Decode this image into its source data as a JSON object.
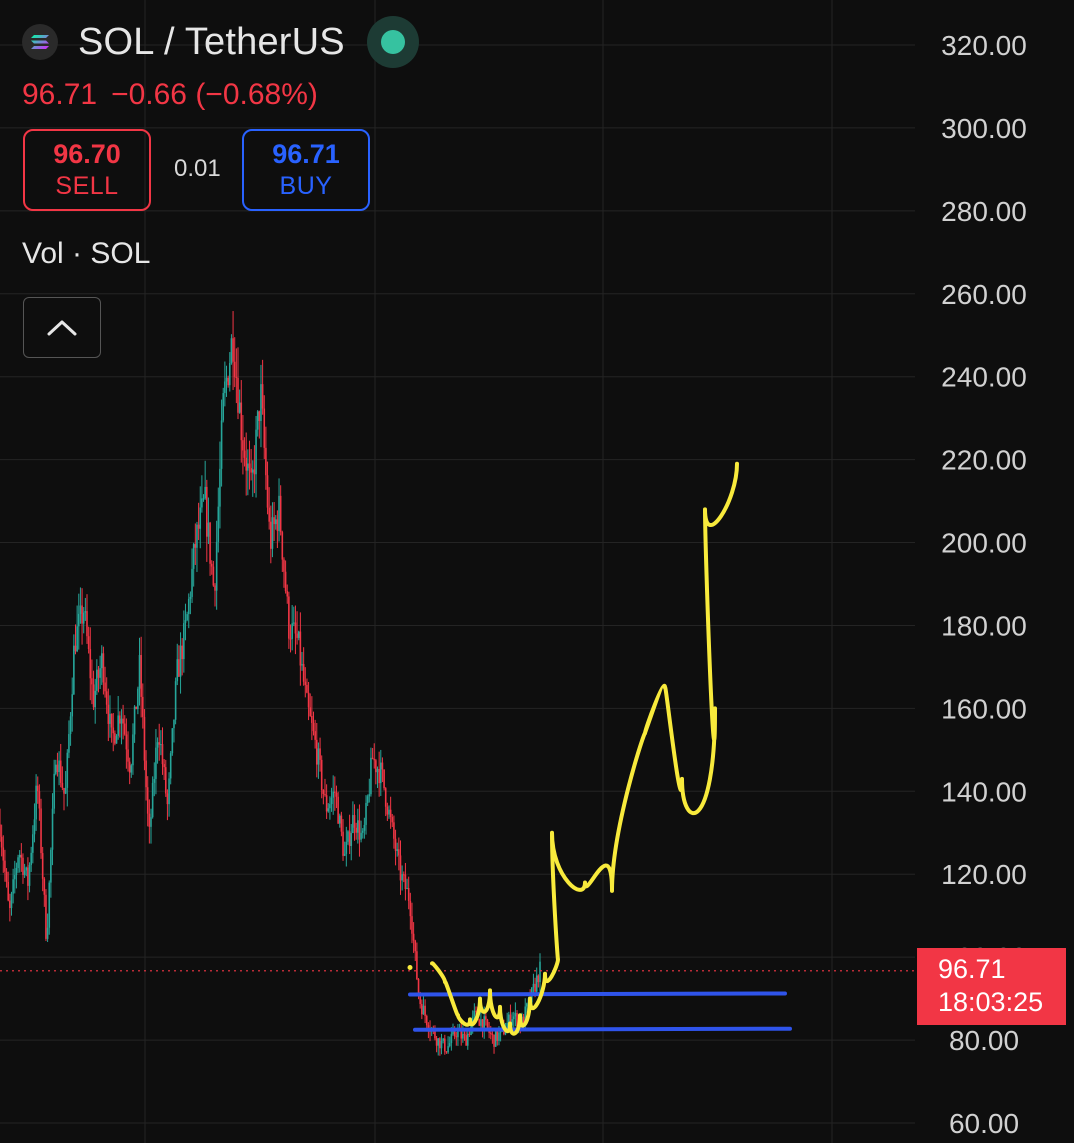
{
  "header": {
    "symbol": "SOL / TetherUS",
    "last_price": "96.71",
    "change": "−0.66 (−0.68%)"
  },
  "trade": {
    "sell_price": "96.70",
    "sell_label": "SELL",
    "spread": "0.01",
    "buy_price": "96.71",
    "buy_label": "BUY"
  },
  "volume_label": "Vol · SOL",
  "price_tag": {
    "price": "96.71",
    "countdown": "18:03:25"
  },
  "colors": {
    "up": "#26a69a",
    "down": "#f23645",
    "accent_blue": "#2962ff",
    "drawing_yellow": "#f8ea3c",
    "drawing_blue": "#2f54eb"
  },
  "icons": {
    "logo": "solana-logo-icon",
    "status": "market-status-dot-icon",
    "collapse": "chevron-up-icon"
  },
  "chart_data": {
    "type": "candlestick",
    "ylim": [
      60,
      320
    ],
    "ytick_labels": [
      "320.00",
      "300.00",
      "280.00",
      "260.00",
      "240.00",
      "220.00",
      "200.00",
      "180.00",
      "160.00",
      "140.00",
      "120.00",
      "100.00",
      "80.00",
      "60.00"
    ],
    "grid": true,
    "current_price": 96.71,
    "close_path": [
      132,
      110,
      126,
      118,
      142,
      104,
      150,
      138,
      176,
      184,
      162,
      172,
      152,
      160,
      146,
      170,
      128,
      156,
      136,
      168,
      180,
      200,
      210,
      188,
      234,
      250,
      226,
      212,
      236,
      200,
      208,
      180,
      176,
      160,
      150,
      136,
      140,
      124,
      134,
      128,
      148,
      144,
      132,
      120,
      114,
      90,
      84,
      80,
      78,
      82,
      80,
      86,
      84,
      80,
      82,
      86,
      84,
      90,
      97
    ],
    "support_lines": [
      91,
      82.5
    ],
    "projection_path": [
      [
        98.5,
        99
      ],
      [
        94,
        95
      ],
      [
        86,
        85
      ],
      [
        85,
        82
      ],
      [
        90,
        85
      ],
      [
        92,
        86
      ],
      [
        88,
        83
      ],
      [
        84,
        80
      ],
      [
        86,
        81
      ],
      [
        90,
        84
      ],
      [
        96,
        91
      ],
      [
        99.5,
        98
      ],
      [
        130,
        119
      ],
      [
        118,
        113
      ],
      [
        116,
        131
      ],
      [
        154,
        155
      ],
      [
        165,
        168
      ],
      [
        143,
        130
      ],
      [
        160,
        130
      ],
      [
        208,
        198
      ],
      [
        219,
        210
      ]
    ]
  }
}
